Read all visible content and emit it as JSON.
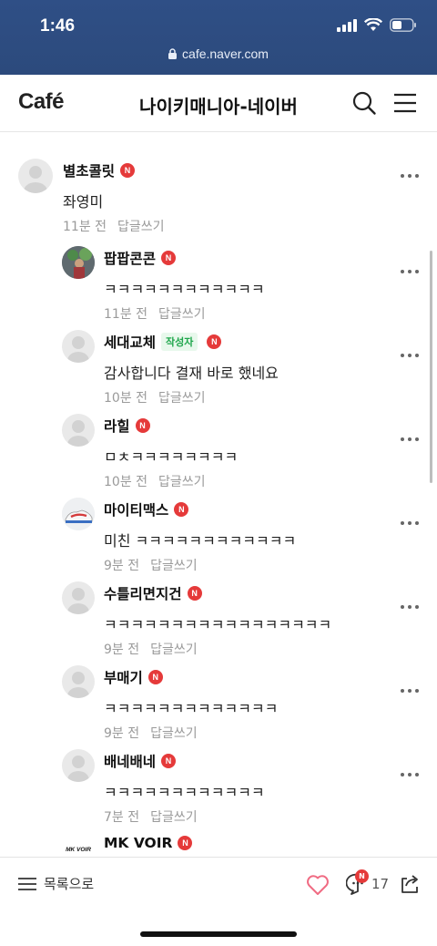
{
  "status_bar": {
    "time": "1:46",
    "url": "cafe.naver.com"
  },
  "header": {
    "logo": "Café",
    "title": "나이키매니아-네이버"
  },
  "comments": [
    {
      "name": "별초콜릿",
      "text": "좌영미",
      "time": "11분 전",
      "reply": "답글쓰기"
    },
    {
      "name": "팝팝콘콘",
      "text": "ㅋㅋㅋㅋㅋㅋㅋㅋㅋㅋㅋㅋ",
      "time": "11분 전",
      "reply": "답글쓰기"
    },
    {
      "name": "세대교체",
      "author_tag": "작성자",
      "text": "감사합니다 결재 바로 했네요",
      "time": "10분 전",
      "reply": "답글쓰기"
    },
    {
      "name": "라힐",
      "text": "ㅁㅊㅋㅋㅋㅋㅋㅋㅋㅋ",
      "time": "10분 전",
      "reply": "답글쓰기"
    },
    {
      "name": "마이티맥스",
      "text": "미친 ㅋㅋㅋㅋㅋㅋㅋㅋㅋㅋㅋㅋ",
      "time": "9분 전",
      "reply": "답글쓰기"
    },
    {
      "name": "수틀리면지건",
      "text": "ㅋㅋㅋㅋㅋㅋㅋㅋㅋㅋㅋㅋㅋㅋㅋㅋㅋ",
      "time": "9분 전",
      "reply": "답글쓰기"
    },
    {
      "name": "부매기",
      "text": "ㅋㅋㅋㅋㅋㅋㅋㅋㅋㅋㅋㅋㅋ",
      "time": "9분 전",
      "reply": "답글쓰기"
    },
    {
      "name": "배네배네",
      "text": "ㅋㅋㅋㅋㅋㅋㅋㅋㅋㅋㅋㅋ",
      "time": "7분 전",
      "reply": "답글쓰기"
    },
    {
      "name": "MK VOIR",
      "avatar_logo": "MK VOIR"
    }
  ],
  "badge_letter": "N",
  "bottom_bar": {
    "list_label": "목록으로",
    "comment_badge": "N",
    "comment_count": "17"
  },
  "colors": {
    "status_bg": "#2c4a7c",
    "badge_red": "#e53a3a",
    "author_green": "#1ea64b"
  }
}
